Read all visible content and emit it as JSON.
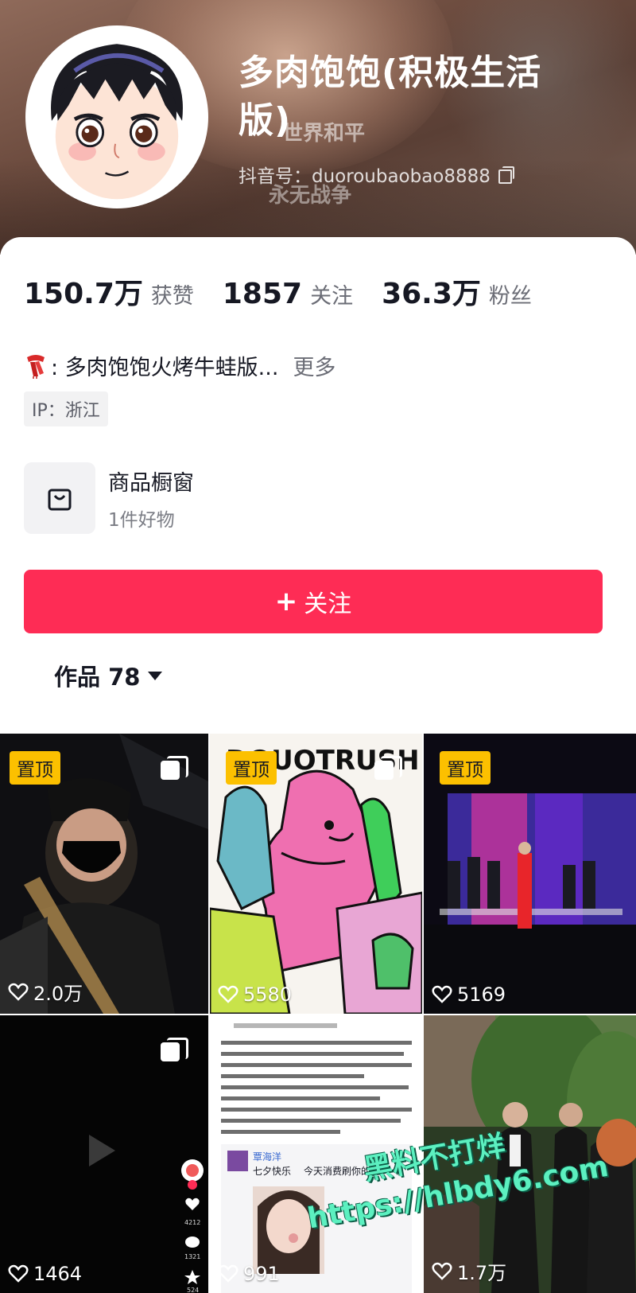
{
  "profile": {
    "display_name": "多肉饱饱(积极生活版)",
    "douyin_id": "抖音号：duoroubaobao8888",
    "bg_text_1": "世界和平",
    "bg_text_2": "永无战争"
  },
  "stats": [
    {
      "value": "150.7万",
      "label": "获赞"
    },
    {
      "value": "1857",
      "label": "关注"
    },
    {
      "value": "36.3万",
      "label": "粉丝"
    }
  ],
  "bio": {
    "text": ": 多肉饱饱火烤牛蛙版...",
    "more": "更多",
    "icon": "scarf-icon"
  },
  "ip": "IP：浙江",
  "shop": {
    "title": "商品橱窗",
    "subtitle": "1件好物",
    "icon": "shopping-bag-icon"
  },
  "follow_button": {
    "label": "关注",
    "icon": "plus-icon",
    "color": "#fe2c55"
  },
  "works_tab": {
    "label": "作品 78"
  },
  "videos": [
    {
      "likes": "2.0万",
      "pinned": "置顶",
      "multi": true
    },
    {
      "likes": "5580",
      "pinned": "置顶",
      "multi": true
    },
    {
      "likes": "5169",
      "pinned": "置顶",
      "multi": false
    },
    {
      "likes": "1464",
      "pinned": "",
      "multi": true
    },
    {
      "likes": "991",
      "pinned": "",
      "multi": false
    },
    {
      "likes": "1.7万",
      "pinned": "",
      "multi": false
    }
  ],
  "thumb_text": {
    "art_title": "DOUOTRUSH",
    "post_name": "覃海洋",
    "post_line": "七夕快乐",
    "post_line_2": "今天消费刷你的卡",
    "side_count_1": "4212",
    "side_count_2": "1321",
    "side_count_3": "524"
  },
  "watermark": {
    "line1": "黑料不打烊",
    "line2": "https://hlbdy6.com"
  },
  "colors": {
    "accent": "#fe2c55",
    "pin": "#fcc000"
  }
}
